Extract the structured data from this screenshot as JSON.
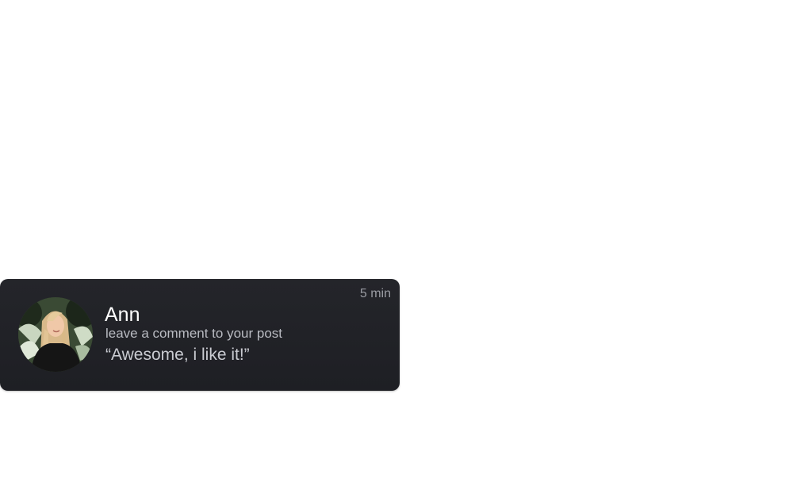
{
  "notification": {
    "sender_name": "Ann",
    "action_text": "leave a comment to your post",
    "message_text": "“Awesome, i like it!”",
    "time_ago": "5 min",
    "avatar_icon": "user-avatar-photo"
  },
  "colors": {
    "card_background": "#222328",
    "name_text": "#ffffff",
    "secondary_text": "#b9bbc2",
    "time_text": "#9a9ca3"
  }
}
